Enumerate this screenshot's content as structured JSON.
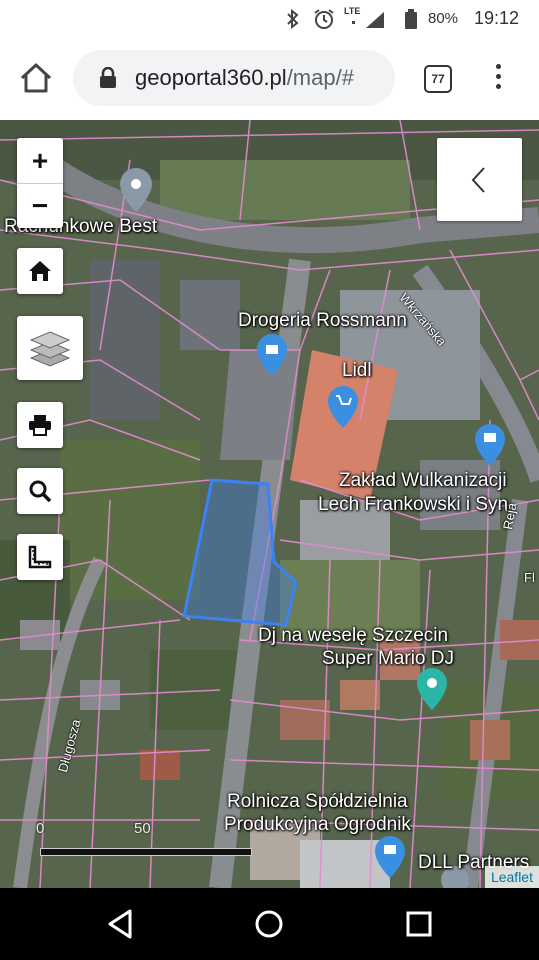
{
  "status_bar": {
    "network": "LTE",
    "battery": "80%",
    "time": "19:12"
  },
  "browser": {
    "url_domain": "geoportal360.pl",
    "url_path": "/map/#",
    "tab_count": "77"
  },
  "map": {
    "places": [
      {
        "id": "rachunkowe",
        "label": "Rachunkowe Best"
      },
      {
        "id": "rossmann",
        "label": "Drogeria Rossmann"
      },
      {
        "id": "lidl",
        "label": "Lidl"
      },
      {
        "id": "zaklad1",
        "label": "Zakład Wulkanizacji"
      },
      {
        "id": "zaklad2",
        "label": "Lech Frankowski i Syn"
      },
      {
        "id": "dj1",
        "label": "Dj na weselę Szczecin"
      },
      {
        "id": "dj2",
        "label": "Super Mario DJ"
      },
      {
        "id": "rolnicza1",
        "label": "Rolnicza Spółdzielnia"
      },
      {
        "id": "rolnicza2",
        "label": "Produkcyjna Ogrodnik"
      },
      {
        "id": "dll",
        "label": "DLL Partners"
      }
    ],
    "streets": {
      "wkrzanska": "Wkrzańska",
      "reja": "Reja",
      "dlugosza": "Długosza",
      "fl": "Fl"
    },
    "controls": {
      "zoom_in": "+",
      "zoom_out": "−"
    },
    "scale": {
      "start": "0",
      "mid": "50"
    },
    "attribution": "Leaflet"
  },
  "colors": {
    "parcel_lines": "#e58bd0",
    "selected_parcel": "#3b82f6",
    "marker_blue": "#3b8fe0",
    "marker_teal": "#2bb5a5",
    "marker_grey": "#8a99a8"
  }
}
